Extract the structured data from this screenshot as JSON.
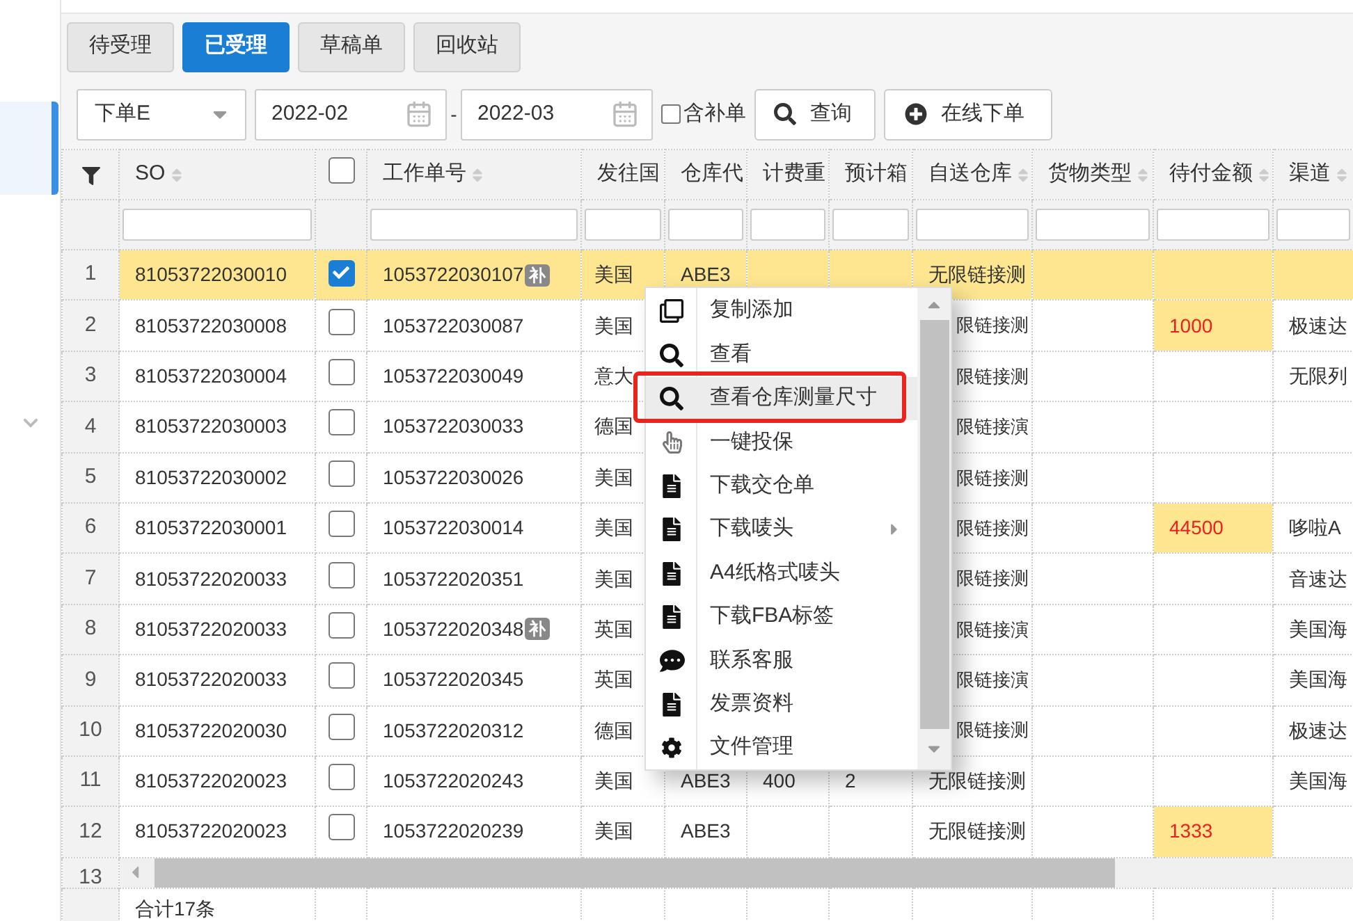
{
  "tabs": [
    {
      "label": "待受理",
      "selected": false
    },
    {
      "label": "已受理",
      "selected": true
    },
    {
      "label": "草稿单",
      "selected": false
    },
    {
      "label": "回收站",
      "selected": false
    }
  ],
  "toolbar": {
    "date_type": {
      "value": "下单E"
    },
    "date_from": {
      "value": "2022-02"
    },
    "separator": "-",
    "date_to": {
      "value": "2022-03"
    },
    "include_supplement": {
      "label": "含补单",
      "checked": false
    },
    "buttons": [
      {
        "label": "查询",
        "kind": "search"
      },
      {
        "label": "在线下单",
        "kind": "add"
      }
    ]
  },
  "table": {
    "select_all": false,
    "columns": [
      {
        "label": "SO",
        "kind": "text",
        "sortable": true
      },
      {
        "label": "工作单号",
        "kind": "text",
        "sortable": true
      },
      {
        "label": "发往国",
        "kind": "text",
        "sortable": false
      },
      {
        "label": "仓库代",
        "kind": "text",
        "sortable": false
      },
      {
        "label": "计费重",
        "kind": "text",
        "sortable": false
      },
      {
        "label": "预计箱",
        "kind": "text",
        "sortable": false
      },
      {
        "label": "自送仓库",
        "kind": "text",
        "sortable": true
      },
      {
        "label": "货物类型",
        "kind": "text",
        "sortable": true
      },
      {
        "label": "待付金额",
        "kind": "text",
        "sortable": true
      },
      {
        "label": "渠道",
        "kind": "text",
        "sortable": true
      }
    ],
    "rows": [
      {
        "number": "1",
        "selected": true,
        "checked": true,
        "covered": false,
        "cells": [
          "81053722030010",
          {
            "text": "1053722030107",
            "badge": "补"
          },
          "美国",
          "ABE3",
          null,
          null,
          "无限链接测",
          null,
          null,
          null
        ]
      },
      {
        "number": "2",
        "selected": false,
        "checked": false,
        "covered": true,
        "cells": [
          "81053722030008",
          "1053722030087",
          "美国",
          null,
          null,
          null,
          "限链接测",
          null,
          {
            "text": "1000",
            "kind": "due"
          },
          "极速达"
        ]
      },
      {
        "number": "3",
        "selected": false,
        "checked": false,
        "covered": true,
        "cells": [
          "81053722030004",
          "1053722030049",
          "意大",
          null,
          null,
          null,
          "限链接测",
          null,
          null,
          "无限列"
        ]
      },
      {
        "number": "4",
        "selected": false,
        "checked": false,
        "covered": true,
        "cells": [
          "81053722030003",
          "1053722030033",
          "德国",
          null,
          null,
          null,
          "限链接演",
          null,
          null,
          null
        ]
      },
      {
        "number": "5",
        "selected": false,
        "checked": false,
        "covered": true,
        "cells": [
          "81053722030002",
          "1053722030026",
          "美国",
          null,
          null,
          null,
          "限链接测",
          null,
          null,
          null
        ]
      },
      {
        "number": "6",
        "selected": false,
        "checked": false,
        "covered": true,
        "cells": [
          "81053722030001",
          "1053722030014",
          "美国",
          null,
          null,
          null,
          "限链接测",
          null,
          {
            "text": "44500",
            "kind": "due"
          },
          "哆啦A"
        ]
      },
      {
        "number": "7",
        "selected": false,
        "checked": false,
        "covered": true,
        "cells": [
          "81053722020033",
          "1053722020351",
          "美国",
          null,
          null,
          null,
          "限链接测",
          null,
          null,
          "音速达"
        ]
      },
      {
        "number": "8",
        "selected": false,
        "checked": false,
        "covered": true,
        "cells": [
          "81053722020033",
          {
            "text": "1053722020348",
            "badge": "补"
          },
          "英国",
          null,
          null,
          null,
          "限链接演",
          null,
          null,
          "美国海"
        ]
      },
      {
        "number": "9",
        "selected": false,
        "checked": false,
        "covered": true,
        "cells": [
          "81053722020033",
          "1053722020345",
          "英国",
          null,
          null,
          null,
          "限链接演",
          null,
          null,
          "美国海"
        ]
      },
      {
        "number": "10",
        "selected": false,
        "checked": false,
        "covered": true,
        "cells": [
          "81053722020030",
          "1053722020312",
          "德国",
          null,
          null,
          null,
          "限链接测",
          null,
          null,
          "极速达"
        ]
      },
      {
        "number": "11",
        "selected": false,
        "checked": false,
        "covered": false,
        "cells": [
          "81053722020023",
          "1053722020243",
          "美国",
          "ABE3",
          "400",
          "2",
          "无限链接测",
          null,
          null,
          "美国海"
        ]
      },
      {
        "number": "12",
        "selected": false,
        "checked": false,
        "covered": false,
        "cells": [
          "81053722020023",
          "1053722020239",
          "美国",
          "ABE3",
          null,
          null,
          "无限链接测",
          null,
          {
            "text": "1333",
            "kind": "due"
          },
          null
        ]
      }
    ],
    "partial_row_number": "13",
    "total": "合计17条"
  },
  "context_menu": {
    "items": [
      {
        "label": "复制添加",
        "kind": "copy",
        "selected": false,
        "submenu": false
      },
      {
        "label": "查看",
        "kind": "view",
        "selected": false,
        "submenu": false
      },
      {
        "label": "查看仓库测量尺寸",
        "kind": "view",
        "selected": true,
        "submenu": false
      },
      {
        "label": "一键投保",
        "kind": "insure",
        "selected": false,
        "submenu": false
      },
      {
        "label": "下载交仓单",
        "kind": "document",
        "selected": false,
        "submenu": false
      },
      {
        "label": "下载唛头",
        "kind": "document",
        "selected": false,
        "submenu": true
      },
      {
        "label": "A4纸格式唛头",
        "kind": "document",
        "selected": false,
        "submenu": false
      },
      {
        "label": "下载FBA标签",
        "kind": "document",
        "selected": false,
        "submenu": false
      },
      {
        "label": "联系客服",
        "kind": "chat",
        "selected": false,
        "submenu": false
      },
      {
        "label": "发票资料",
        "kind": "document",
        "selected": false,
        "submenu": false
      },
      {
        "label": "文件管理",
        "kind": "settings",
        "selected": false,
        "submenu": false
      }
    ]
  }
}
